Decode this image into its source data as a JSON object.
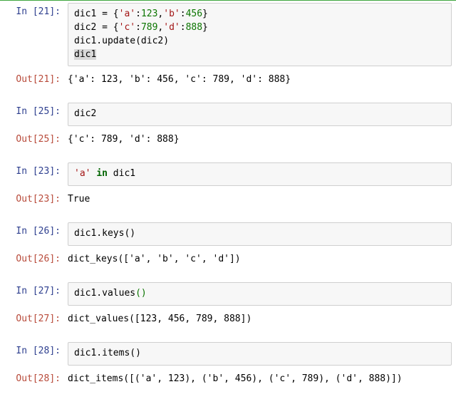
{
  "cells": [
    {
      "prompt_in": "In [21]:",
      "prompt_out": "Out[21]:",
      "output": "{'a': 123, 'b': 456, 'c': 789, 'd': 888}",
      "line1_p0": "dic1 = {",
      "line1_s1": "'a'",
      "line1_p1": ":",
      "line1_n1": "123",
      "line1_p2": ",",
      "line1_s2": "'b'",
      "line1_p3": ":",
      "line1_n2": "456",
      "line1_p4": "}",
      "line2_p0": "dic2 = {",
      "line2_s1": "'c'",
      "line2_p1": ":",
      "line2_n1": "789",
      "line2_p2": ",",
      "line2_s2": "'d'",
      "line2_p3": ":",
      "line2_n2": "888",
      "line2_p4": "}",
      "line3": "dic1.update(dic2)",
      "line4": "dic1"
    },
    {
      "prompt_in": "In [25]:",
      "prompt_out": "Out[25]:",
      "code": "dic2",
      "output": "{'c': 789, 'd': 888}"
    },
    {
      "prompt_in": "In [23]:",
      "prompt_out": "Out[23]:",
      "code_s": "'a'",
      "code_sp": " ",
      "code_k": "in",
      "code_rest": " dic1",
      "output": "True"
    },
    {
      "prompt_in": "In [26]:",
      "prompt_out": "Out[26]:",
      "code": "dic1.keys()",
      "output": "dict_keys(['a', 'b', 'c', 'd'])"
    },
    {
      "prompt_in": "In [27]:",
      "prompt_out": "Out[27]:",
      "code_pre": "dic1.values",
      "code_paren": "()",
      "output": "dict_values([123, 456, 789, 888])"
    },
    {
      "prompt_in": "In [28]:",
      "prompt_out": "Out[28]:",
      "code": "dic1.items()",
      "output": "dict_items([('a', 123), ('b', 456), ('c', 789), ('d', 888)])"
    }
  ]
}
